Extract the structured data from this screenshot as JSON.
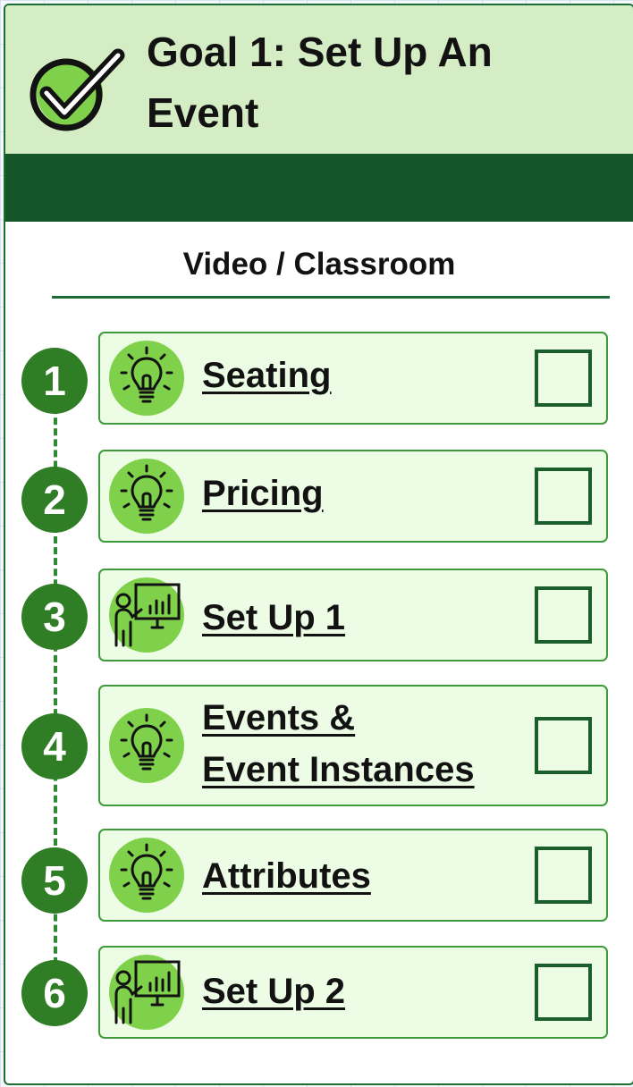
{
  "header": {
    "title_line1": "Goal 1: Set Up An",
    "title_line2": "Event",
    "icon": "check-badge-icon",
    "background": "#d5edc4",
    "band_color": "#15552a"
  },
  "section": {
    "title": "Video / Classroom"
  },
  "steps": [
    {
      "number": "1",
      "label_line1": "Seating",
      "label_line2": "",
      "icon": "lightbulb-icon",
      "checked": false
    },
    {
      "number": "2",
      "label_line1": "Pricing",
      "label_line2": "",
      "icon": "lightbulb-icon",
      "checked": false
    },
    {
      "number": "3",
      "label_line1": "Set Up 1",
      "label_line2": "",
      "icon": "presentation-icon",
      "checked": false
    },
    {
      "number": "4",
      "label_line1": "Events &",
      "label_line2": "Event Instances",
      "icon": "lightbulb-icon",
      "checked": false
    },
    {
      "number": "5",
      "label_line1": "Attributes",
      "label_line2": "",
      "icon": "lightbulb-icon",
      "checked": false
    },
    {
      "number": "6",
      "label_line1": "Set Up 2",
      "label_line2": "",
      "icon": "presentation-icon",
      "checked": false
    }
  ],
  "colors": {
    "accent": "#2f7d24",
    "item_background": "#edfde5",
    "icon_circle": "#7fd14b",
    "border": "#1e6b36"
  }
}
